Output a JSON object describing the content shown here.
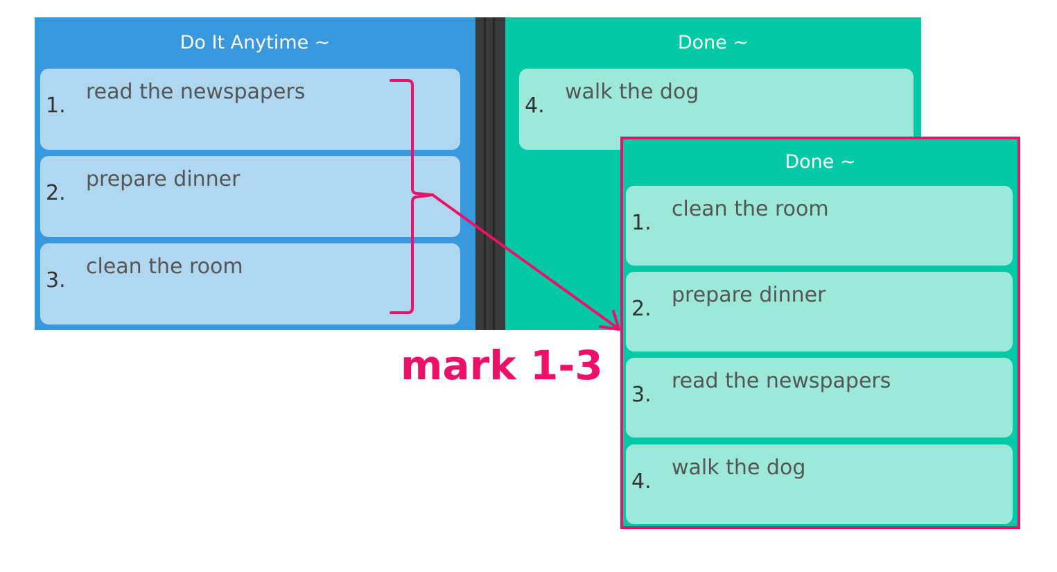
{
  "columns": {
    "anytime": {
      "title": "Do It Anytime ~",
      "items": [
        {
          "num": "1.",
          "text": "read the newspapers"
        },
        {
          "num": "2.",
          "text": "prepare dinner"
        },
        {
          "num": "3.",
          "text": "clean the room"
        }
      ]
    },
    "done": {
      "title": "Done ~",
      "items": [
        {
          "num": "4.",
          "text": "walk the dog"
        }
      ]
    }
  },
  "result_panel": {
    "title": "Done ~",
    "items": [
      {
        "num": "1.",
        "text": "clean the room"
      },
      {
        "num": "2.",
        "text": "prepare dinner"
      },
      {
        "num": "3.",
        "text": "read the newspapers"
      },
      {
        "num": "4.",
        "text": "walk the dog"
      }
    ]
  },
  "annotation": {
    "label": "mark 1-3",
    "color": "#ee0f69"
  },
  "colors": {
    "anytime_bg": "#3898dd",
    "anytime_card": "#afd7f0",
    "done_bg": "#03c9a7",
    "done_card": "#9ce9da"
  }
}
